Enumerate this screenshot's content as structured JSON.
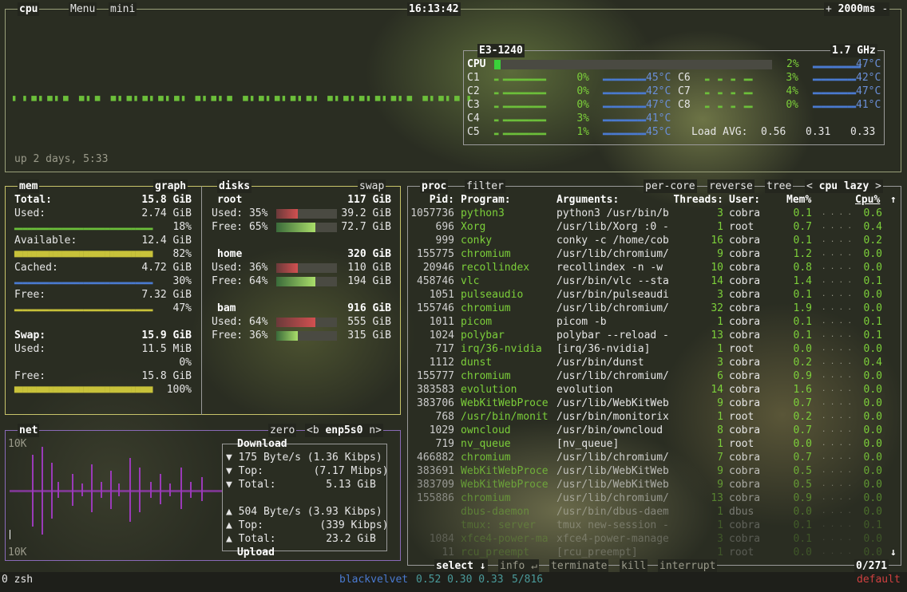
{
  "top": {
    "cpu_tab": "cpu",
    "menu_tab": "Menu",
    "mini_tab": "mini",
    "clock": "16:13:42",
    "plus": "+",
    "interval": "2000ms",
    "minus": "-",
    "uptime": "up 2 days, 5:33"
  },
  "cpu_box": {
    "model": "E3-1240",
    "freq": "1.7 GHz",
    "total_label": "CPU",
    "total_pct": "2%",
    "total_fill": 0.02,
    "total_temp": "47°C",
    "cores_left": [
      {
        "name": "C1",
        "pct": "0%",
        "temp": "45°C"
      },
      {
        "name": "C2",
        "pct": "0%",
        "temp": "42°C"
      },
      {
        "name": "C3",
        "pct": "0%",
        "temp": "47°C"
      },
      {
        "name": "C4",
        "pct": "3%",
        "temp": "41°C"
      },
      {
        "name": "C5",
        "pct": "1%",
        "temp": "45°C"
      }
    ],
    "cores_right": [
      {
        "name": "C6",
        "pct": "3%",
        "temp": "42°C"
      },
      {
        "name": "C7",
        "pct": "4%",
        "temp": "47°C"
      },
      {
        "name": "C8",
        "pct": "0%",
        "temp": "41°C"
      }
    ],
    "load_label": "Load AVG:",
    "load": [
      "0.56",
      "0.31",
      "0.33"
    ]
  },
  "mem": {
    "tab": "mem",
    "graph_tab": "graph",
    "total_label": "Total:",
    "total": "15.8 GiB",
    "used_label": "Used:",
    "used": "2.74 GiB",
    "used_pct": "18%",
    "available_label": "Available:",
    "available": "12.4 GiB",
    "available_pct": "82%",
    "cached_label": "Cached:",
    "cached": "4.72 GiB",
    "cached_pct": "30%",
    "free_label": "Free:",
    "free": "7.32 GiB",
    "free_pct": "47%",
    "swap_label": "Swap:",
    "swap": "15.9 GiB",
    "swap_used_label": "Used:",
    "swap_used": "11.5 MiB",
    "swap_used_pct": "0%",
    "swap_free_label": "Free:",
    "swap_free": "15.8 GiB",
    "swap_free_pct": "100%"
  },
  "disks": {
    "tab": "disks",
    "swap_tab": "swap",
    "items": [
      {
        "name": "root",
        "size": "117 GiB",
        "used": "Used: 35%",
        "used_val": "39.2 GiB",
        "used_fill": 0.35,
        "free": "Free: 65%",
        "free_val": "72.7 GiB",
        "free_fill": 0.65
      },
      {
        "name": "home",
        "size": "320 GiB",
        "used": "Used: 36%",
        "used_val": "110 GiB",
        "used_fill": 0.36,
        "free": "Free: 64%",
        "free_val": "194 GiB",
        "free_fill": 0.64
      },
      {
        "name": "bam",
        "size": "916 GiB",
        "used": "Used: 64%",
        "used_val": "555 GiB",
        "used_fill": 0.64,
        "free": "Free: 36%",
        "free_val": "315 GiB",
        "free_fill": 0.36
      }
    ]
  },
  "net": {
    "tab": "net",
    "zero_tab": "zero",
    "iface_prev": "<b",
    "iface": "enp5s0",
    "iface_next": "n>",
    "scale_top": "10K",
    "scale_bottom": "10K",
    "download_label": "Download",
    "dl_rate": "175 Byte/s (1.36 Kibps)",
    "dl_top": "Top:        (7.17 Mibps)",
    "dl_total": "Total:        5.13 GiB",
    "ul_rate": "504 Byte/s (3.93 Kibps)",
    "ul_top": "Top:         (339 Kibps)",
    "ul_total": "Total:        23.2 GiB",
    "upload_label": "Upload"
  },
  "proc": {
    "tab": "proc",
    "filter_tab": "filter",
    "percore_tab": "per-core",
    "reverse_tab": "reverse",
    "tree_tab": "tree",
    "sort_prev": "<",
    "sort_label": "cpu lazy",
    "sort_next": ">",
    "headers": {
      "pid": "Pid:",
      "program": "Program:",
      "args": "Arguments:",
      "threads": "Threads:",
      "user": "User:",
      "mem": "Mem%",
      "cpu": "Cpu%"
    },
    "rows": [
      {
        "pid": "1057736",
        "program": "python3",
        "args": "python3 /usr/bin/bpyt",
        "threads": "3",
        "user": "cobra",
        "mem": "0.1",
        "cpu": "0.6"
      },
      {
        "pid": "696",
        "program": "Xorg",
        "args": "/usr/lib/Xorg :0 -sea",
        "threads": "1",
        "user": "root",
        "mem": "0.7",
        "cpu": "0.4"
      },
      {
        "pid": "999",
        "program": "conky",
        "args": "conky -c /home/cobra/",
        "threads": "16",
        "user": "cobra",
        "mem": "0.1",
        "cpu": "0.2"
      },
      {
        "pid": "155775",
        "program": "chromium",
        "args": "/usr/lib/chromium/chr",
        "threads": "9",
        "user": "cobra",
        "mem": "1.2",
        "cpu": "0.0"
      },
      {
        "pid": "20946",
        "program": "recollindex",
        "args": "recollindex -n -w 60",
        "threads": "10",
        "user": "cobra",
        "mem": "0.8",
        "cpu": "0.0"
      },
      {
        "pid": "458746",
        "program": "vlc",
        "args": "/usr/bin/vlc --starte",
        "threads": "14",
        "user": "cobra",
        "mem": "1.4",
        "cpu": "0.1"
      },
      {
        "pid": "1051",
        "program": "pulseaudio",
        "args": "/usr/bin/pulseaudio -",
        "threads": "3",
        "user": "cobra",
        "mem": "0.1",
        "cpu": "0.0"
      },
      {
        "pid": "155746",
        "program": "chromium",
        "args": "/usr/lib/chromium/chr",
        "threads": "32",
        "user": "cobra",
        "mem": "1.9",
        "cpu": "0.0"
      },
      {
        "pid": "1011",
        "program": "picom",
        "args": "picom -b",
        "threads": "1",
        "user": "cobra",
        "mem": "0.1",
        "cpu": "0.1"
      },
      {
        "pid": "1024",
        "program": "polybar",
        "args": "polybar --reload --co",
        "threads": "13",
        "user": "cobra",
        "mem": "0.1",
        "cpu": "0.1"
      },
      {
        "pid": "717",
        "program": "irq/36-nvidia",
        "args": "[irq/36-nvidia]",
        "threads": "1",
        "user": "root",
        "mem": "0.0",
        "cpu": "0.0"
      },
      {
        "pid": "1112",
        "program": "dunst",
        "args": "/usr/bin/dunst",
        "threads": "3",
        "user": "cobra",
        "mem": "0.2",
        "cpu": "0.4"
      },
      {
        "pid": "155777",
        "program": "chromium",
        "args": "/usr/lib/chromium/chr",
        "threads": "6",
        "user": "cobra",
        "mem": "0.9",
        "cpu": "0.0"
      },
      {
        "pid": "383583",
        "program": "evolution",
        "args": "evolution",
        "threads": "14",
        "user": "cobra",
        "mem": "1.6",
        "cpu": "0.0"
      },
      {
        "pid": "383706",
        "program": "WebKitWebProce",
        "args": "/usr/lib/WebKitWebPro",
        "threads": "9",
        "user": "cobra",
        "mem": "0.7",
        "cpu": "0.0"
      },
      {
        "pid": "768",
        "program": "/usr/bin/monit",
        "args": "/usr/bin/monitorix -c",
        "threads": "1",
        "user": "root",
        "mem": "0.2",
        "cpu": "0.0"
      },
      {
        "pid": "1029",
        "program": "owncloud",
        "args": "/usr/bin/owncloud",
        "threads": "8",
        "user": "cobra",
        "mem": "0.7",
        "cpu": "0.0"
      },
      {
        "pid": "719",
        "program": "nv_queue",
        "args": "[nv_queue]",
        "threads": "1",
        "user": "root",
        "mem": "0.0",
        "cpu": "0.0"
      },
      {
        "pid": "466882",
        "program": "chromium",
        "args": "/usr/lib/chromium/chr",
        "threads": "7",
        "user": "cobra",
        "mem": "0.7",
        "cpu": "0.0"
      },
      {
        "pid": "383691",
        "program": "WebKitWebProce",
        "args": "/usr/lib/WebKitWebPro",
        "threads": "9",
        "user": "cobra",
        "mem": "0.5",
        "cpu": "0.0"
      },
      {
        "pid": "383709",
        "program": "WebKitWebProce",
        "args": "/usr/lib/WebKitWebPro",
        "threads": "9",
        "user": "cobra",
        "mem": "0.5",
        "cpu": "0.0"
      },
      {
        "pid": "155886",
        "program": "chromium",
        "args": "/usr/lib/chromium/chr",
        "threads": "13",
        "user": "cobra",
        "mem": "0.9",
        "cpu": "0.0"
      },
      {
        "pid": "",
        "program": "dbus-daemon",
        "args": "/usr/bin/dbus-daemon",
        "threads": "1",
        "user": "dbus",
        "mem": "0.0",
        "cpu": "0.0"
      },
      {
        "pid": "",
        "program": "tmux: server",
        "args": "tmux new-session -s d",
        "threads": "1",
        "user": "cobra",
        "mem": "0.1",
        "cpu": "0.1"
      },
      {
        "pid": "1084",
        "program": "xfce4-power-ma",
        "args": "xfce4-power-manager",
        "threads": "3",
        "user": "cobra",
        "mem": "0.1",
        "cpu": "0.0"
      },
      {
        "pid": "11",
        "program": "rcu_preempt",
        "args": "[rcu_preempt]",
        "threads": "1",
        "user": "root",
        "mem": "0.0",
        "cpu": "0.0"
      }
    ],
    "select_label": "select ↓",
    "info_label": "info ↵",
    "terminate_label": "terminate",
    "kill_label": "kill",
    "interrupt_label": "interrupt",
    "count": "0/271"
  },
  "status": {
    "window": "0 zsh",
    "host": "blackvelvet",
    "load": "0.52 0.30 0.33",
    "procs": "5/816",
    "profile": "default"
  },
  "colors": {
    "accent_green": "#7ccf3a",
    "temp_blue": "#6a8fd8",
    "mem_yellow": "#c8c23a",
    "net_purple": "#8a6ab8",
    "status_blue": "#4a7ad0",
    "status_red": "#d04040"
  }
}
